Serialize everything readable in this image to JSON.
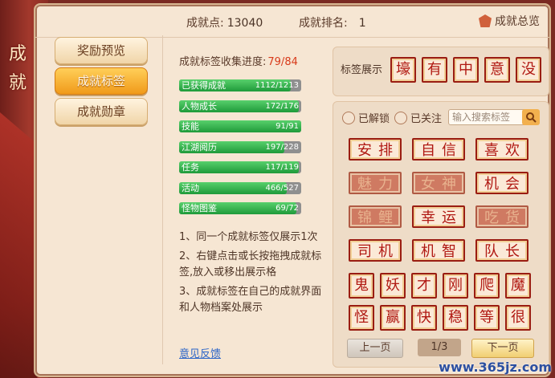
{
  "window": {
    "side_title": "成就"
  },
  "header": {
    "points_label": "成就点:",
    "points_value": "13040",
    "rank_label": "成就排名:",
    "rank_value": "1",
    "overview_label": "成就总览"
  },
  "nav": {
    "items": [
      {
        "label": "奖励预览"
      },
      {
        "label": "成就标签",
        "active": true
      },
      {
        "label": "成就勋章"
      }
    ]
  },
  "progress": {
    "title": "成就标签收集进度:",
    "value": "79/84",
    "bars": [
      {
        "label": "已获得成就",
        "count": "1112/1213",
        "ratio": 0.917
      },
      {
        "label": "人物成长",
        "count": "172/176",
        "ratio": 0.977
      },
      {
        "label": "技能",
        "count": "91/91",
        "ratio": 1.0
      },
      {
        "label": "江湖阅历",
        "count": "197/228",
        "ratio": 0.864
      },
      {
        "label": "任务",
        "count": "117/119",
        "ratio": 0.983
      },
      {
        "label": "活动",
        "count": "466/527",
        "ratio": 0.884
      },
      {
        "label": "怪物图鉴",
        "count": "69/72",
        "ratio": 0.958
      }
    ]
  },
  "notes": [
    "1、同一个成就标签仅展示1次",
    "2、右键点击或长按拖拽成就标签,放入或移出展示格",
    "3、成就标签在自己的成就界面和人物档案处展示"
  ],
  "feedback_label": "意见反馈",
  "display": {
    "label": "标签展示",
    "tags": [
      "壕",
      "有",
      "中",
      "意",
      "没"
    ]
  },
  "filters": {
    "unlocked": "已解锁",
    "followed": "已关注",
    "search_placeholder": "输入搜索标签"
  },
  "tags": [
    {
      "text": "安排",
      "locked": false
    },
    {
      "text": "自信",
      "locked": false
    },
    {
      "text": "喜欢",
      "locked": false
    },
    {
      "text": "魅力",
      "locked": true
    },
    {
      "text": "女神",
      "locked": true
    },
    {
      "text": "机会",
      "locked": false
    },
    {
      "text": "锦鲤",
      "locked": true
    },
    {
      "text": "幸运",
      "locked": false
    },
    {
      "text": "吃货",
      "locked": true
    },
    {
      "text": "司机",
      "locked": false
    },
    {
      "text": "机智",
      "locked": false
    },
    {
      "text": "队长",
      "locked": false
    }
  ],
  "small_tags": [
    "鬼",
    "妖",
    "才",
    "刚",
    "爬",
    "魔",
    "怪",
    "赢",
    "快",
    "稳",
    "等",
    "很"
  ],
  "pagination": {
    "prev": "上一页",
    "page": "1/3",
    "next": "下一页"
  },
  "watermark": "www.365jz.com",
  "colors": {
    "accent": "#f09a1a",
    "tag_red": "#9a1d12",
    "progress_green": "#1f9a3a",
    "highlight": "#d83a1a"
  }
}
